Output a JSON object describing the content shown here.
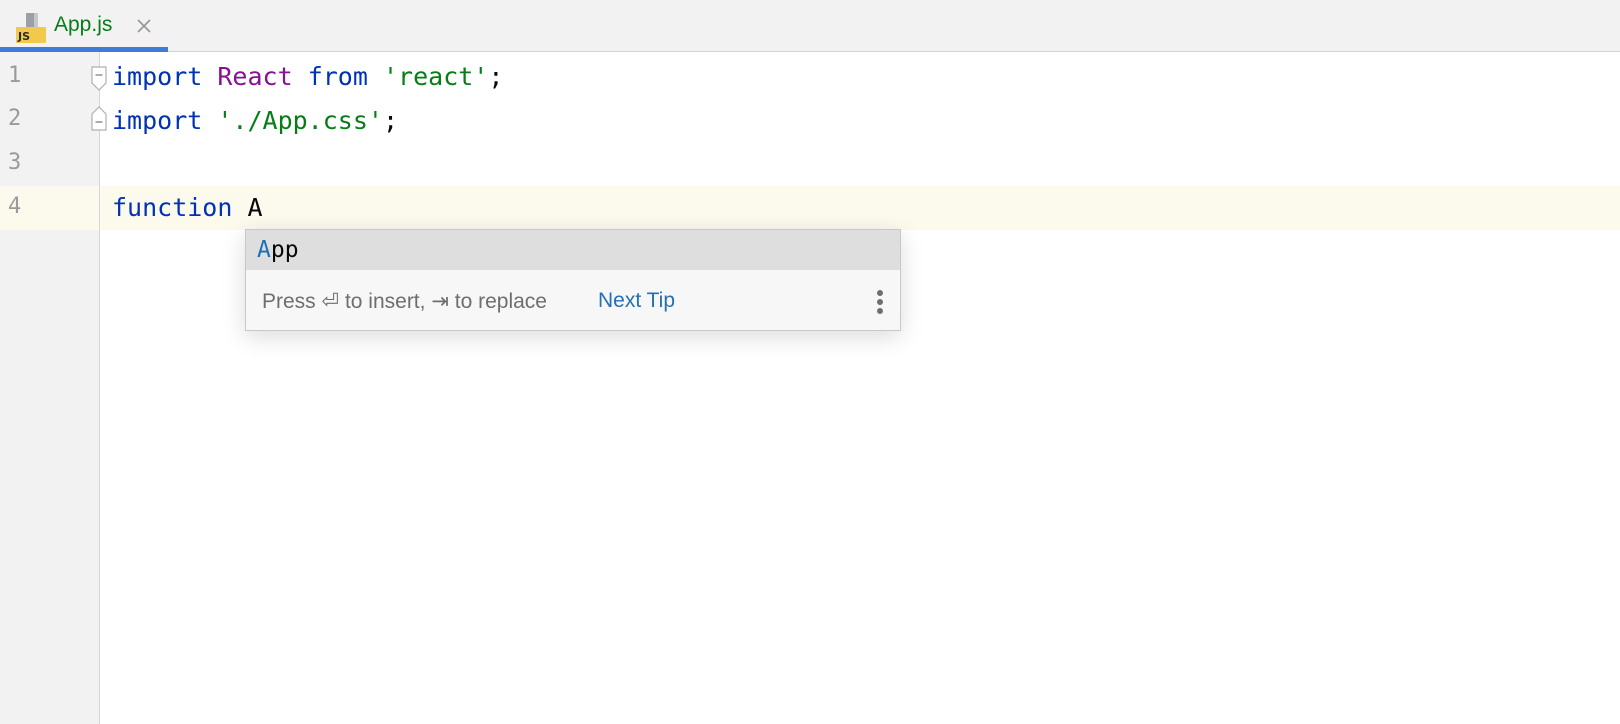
{
  "tab": {
    "icon": "javascript-file-icon",
    "icon_text": "JS",
    "label": "App.js",
    "close_icon": "close-icon"
  },
  "colors": {
    "keyword": "#0033b3",
    "string": "#067d17",
    "identifier": "#871094",
    "tab_underline": "#3d7bd6",
    "link": "#2470b3"
  },
  "gutter": {
    "line_numbers": [
      "1",
      "2",
      "3",
      "4"
    ]
  },
  "code": {
    "line1": {
      "kw1": "import",
      "ident": "React",
      "kw2": "from",
      "str": "'react'",
      "end": ";"
    },
    "line2": {
      "kw1": "import",
      "str": "'./App.css'",
      "end": ";"
    },
    "line3": "",
    "line4": {
      "kw1": "function",
      "typed": "A"
    }
  },
  "completion": {
    "item_match": "A",
    "item_rest": "pp",
    "hint": "Press ⏎ to insert, ⇥ to replace",
    "next_tip": "Next Tip",
    "more_icon": "vertical-ellipsis-icon"
  }
}
